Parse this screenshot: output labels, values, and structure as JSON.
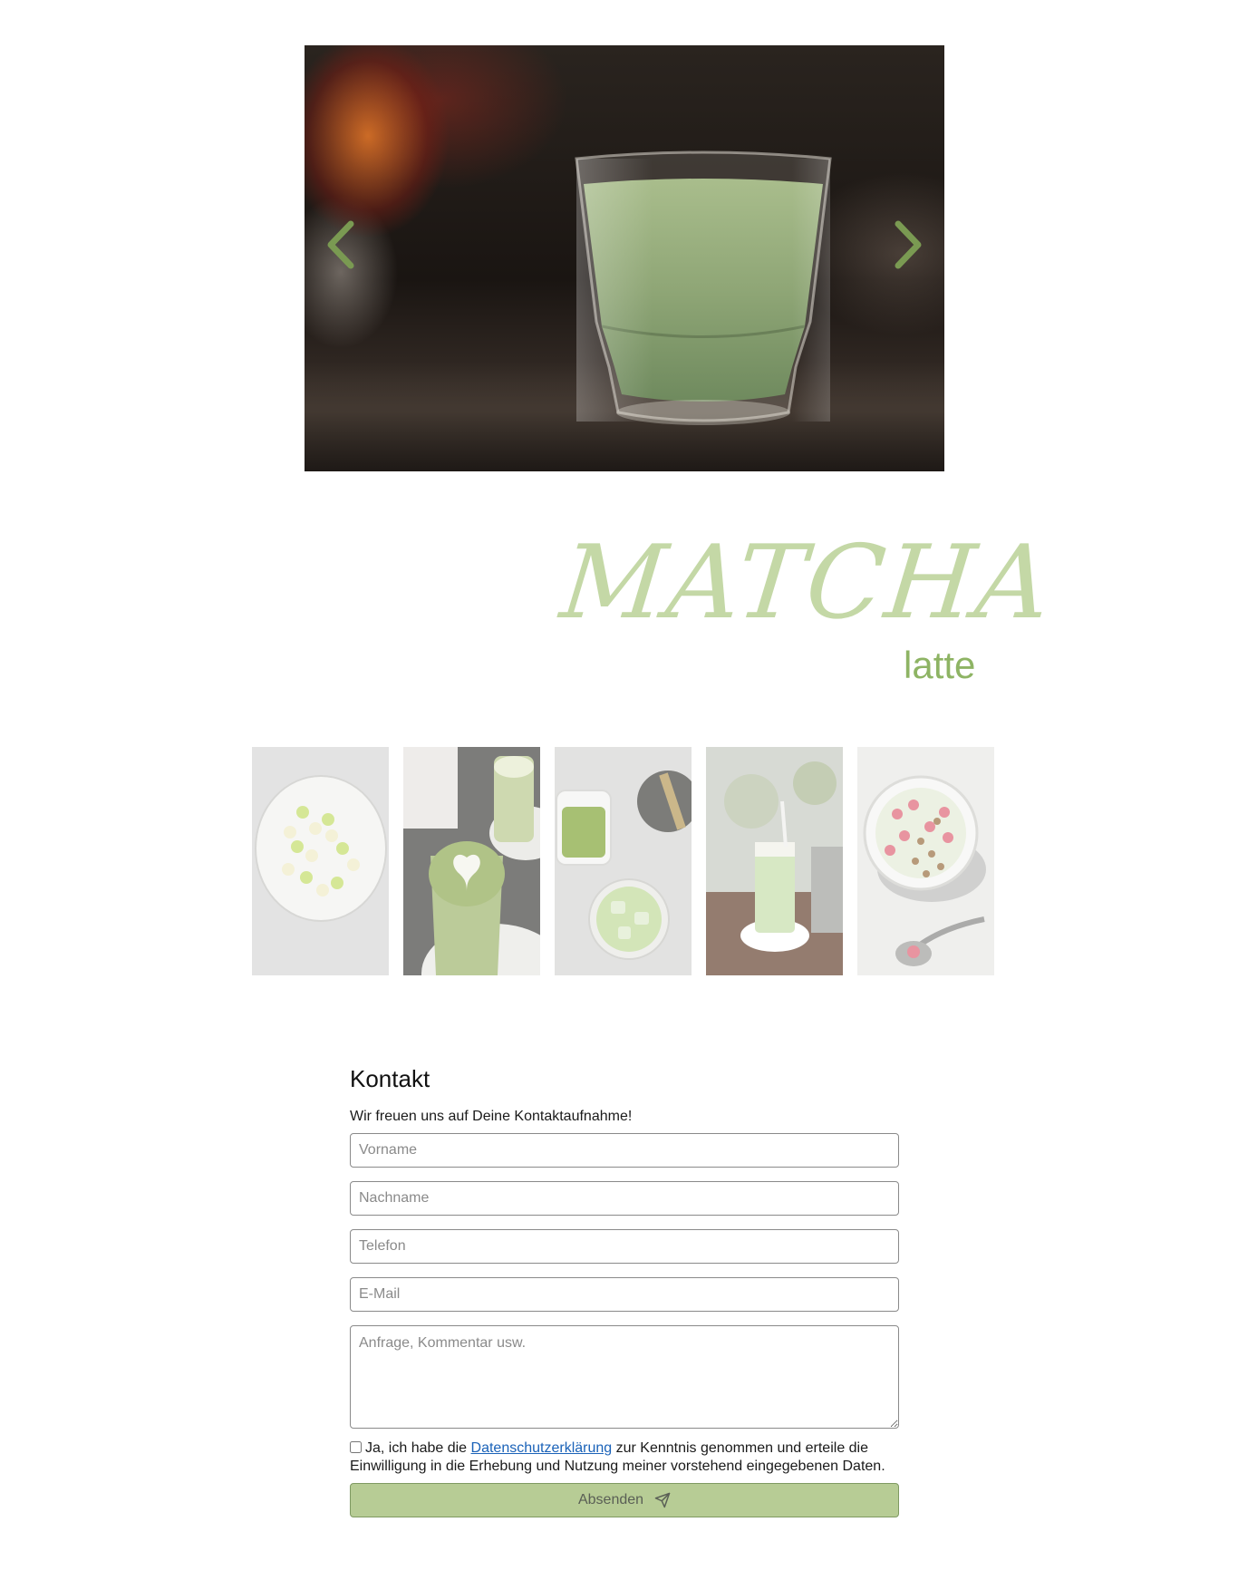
{
  "slider": {
    "prev_icon": "chevron-left-icon",
    "next_icon": "chevron-right-icon",
    "accent": "#7a9a52"
  },
  "hero": {
    "title": "MATCHA",
    "subtitle": "latte",
    "title_color": "#c4d8a6",
    "subtitle_color": "#8eb464"
  },
  "gallery": {
    "tiles": [
      "heart-candies-image",
      "matcha-latte-art-image",
      "matcha-powder-iced-image",
      "iced-matcha-glass-image",
      "matcha-bowl-raspberry-image"
    ]
  },
  "contact": {
    "heading": "Kontakt",
    "intro": "Wir freuen uns auf Deine Kontaktaufnahme!",
    "first_name_placeholder": "Vorname",
    "last_name_placeholder": "Nachname",
    "phone_placeholder": "Telefon",
    "email_placeholder": "E-Mail",
    "message_placeholder": "Anfrage, Kommentar usw.",
    "consent_before": "Ja, ich habe die ",
    "consent_link": "Datenschutzerklärung",
    "consent_after": " zur Kenntnis genommen und erteile die Einwilligung in die Erhebung und Nutzung meiner vorstehend eingegebenen Daten.",
    "submit_label": "Absenden",
    "submit_icon": "paper-plane-icon",
    "submit_color": "#b7cc95"
  }
}
